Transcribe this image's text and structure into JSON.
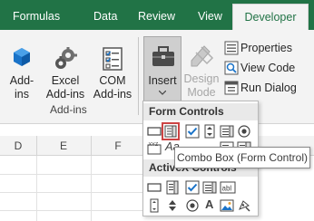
{
  "tabs": [
    "Formulas",
    "Data",
    "Review",
    "View",
    "Developer"
  ],
  "ribbon": {
    "addins": {
      "addins_label": "Add-ins",
      "excel_addins_label": "Excel Add-ins",
      "com_addins_label": "COM Add-ins",
      "group_label": "Add-ins"
    },
    "controls": {
      "insert_label": "Insert",
      "design_mode_label": "Design Mode",
      "properties_label": "Properties",
      "view_code_label": "View Code",
      "run_dialog_label": "Run Dialog"
    }
  },
  "columns": [
    "D",
    "E",
    "F"
  ],
  "dropdown": {
    "form_controls_header": "Form Controls",
    "activex_header": "ActiveX Controls",
    "form_controls_row1": [
      "button-icon",
      "combo-box-icon",
      "check-box-icon",
      "spin-button-icon",
      "list-box-icon",
      "option-button-icon"
    ],
    "form_controls_row2": [
      "group-box-icon",
      "label-icon",
      "scroll-bar-icon",
      "text-field-icon",
      "combo-list-edit-icon",
      "combo-drop-down-icon"
    ],
    "activex_row1": [
      "command-button-icon",
      "combo-box-icon",
      "check-box-icon",
      "list-box-icon",
      "text-box-icon"
    ],
    "activex_row2": [
      "scroll-bar-icon",
      "spin-button-icon",
      "option-button-icon",
      "label-icon",
      "image-icon",
      "more-controls-icon"
    ],
    "row2_text_glyphs": {
      "form_label": "Aa",
      "activex_label": "A"
    }
  },
  "tooltip": {
    "text": "Combo Box (Form Control)"
  },
  "colors": {
    "tab_bar": "#217346",
    "ribbon_bg": "#f3f3f3",
    "highlight": "#cc4444",
    "accent_blue": "#1a73c8"
  }
}
